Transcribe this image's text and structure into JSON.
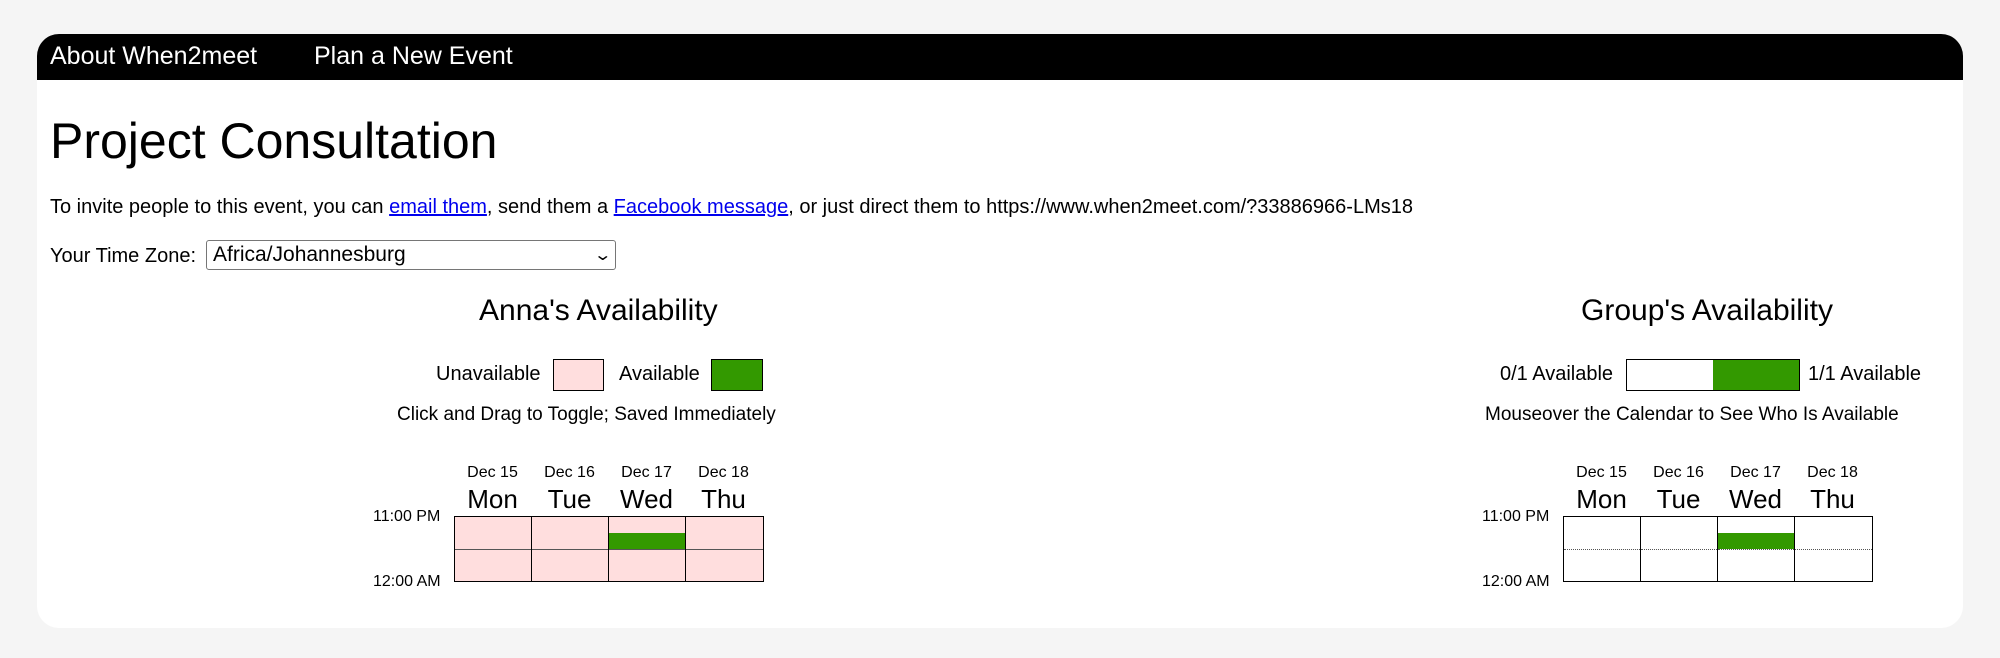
{
  "nav": {
    "about": "About When2meet",
    "plan": "Plan a New Event"
  },
  "event": {
    "title": "Project Consultation"
  },
  "invite": {
    "prefix": "To invite people to this event, you can ",
    "email_link": "email them",
    "middle": ", send them a ",
    "facebook_link": "Facebook message",
    "suffix": ", or just direct them to https://www.when2meet.com/?33886966-LMs18"
  },
  "timezone": {
    "label": "Your Time Zone:",
    "value": "Africa/Johannesburg"
  },
  "personal": {
    "title": "Anna's Availability",
    "unavailable_label": "Unavailable",
    "available_label": "Available",
    "instructions": "Click and Drag to Toggle; Saved Immediately"
  },
  "group": {
    "title": "Group's Availability",
    "min_label": "0/1 Available",
    "max_label": "1/1 Available",
    "instructions": "Mouseover the Calendar to See Who Is Available"
  },
  "days": [
    {
      "date": "Dec 15",
      "name": "Mon"
    },
    {
      "date": "Dec 16",
      "name": "Tue"
    },
    {
      "date": "Dec 17",
      "name": "Wed"
    },
    {
      "date": "Dec 18",
      "name": "Thu"
    }
  ],
  "times": {
    "start": "11:00 PM",
    "end": "12:00 AM"
  },
  "colors": {
    "unavailable": "#ffdede",
    "available": "#339900",
    "group_none": "#ffffff"
  },
  "slots_per_day": 4,
  "availability": [
    [
      0,
      0,
      0,
      0
    ],
    [
      0,
      0,
      0,
      0
    ],
    [
      0,
      1,
      0,
      0
    ],
    [
      0,
      0,
      0,
      0
    ]
  ]
}
